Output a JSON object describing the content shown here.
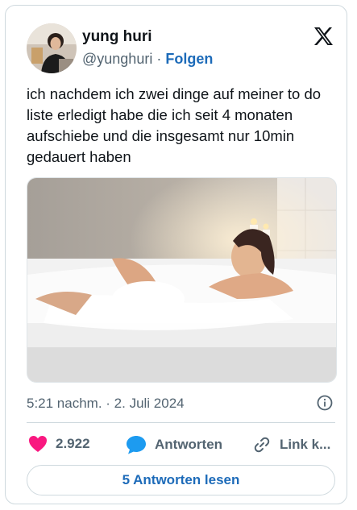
{
  "author": {
    "display_name": "yung huri",
    "handle": "@yunghuri",
    "separator": "·",
    "follow_label": "Folgen"
  },
  "tweet": {
    "text": "ich nachdem ich zwei dinge auf meiner to do liste erledigt habe die ich seit 4 monaten aufschiebe und die insgesamt nur 10min gedauert haben",
    "timestamp": "5:21 nachm. · 2. Juli 2024"
  },
  "actions": {
    "likes_count": "2.922",
    "reply_label": "Antworten",
    "link_label": "Link k..."
  },
  "read_replies_label": "5 Antworten lesen",
  "colors": {
    "accent": "#1d6bb9",
    "like": "#f91880",
    "reply_bubble": "#1d9bf0",
    "muted": "#536471",
    "border": "#cfd9de"
  },
  "icons": [
    "x-logo-icon",
    "heart-icon",
    "reply-bubble-icon",
    "link-icon",
    "info-icon"
  ]
}
